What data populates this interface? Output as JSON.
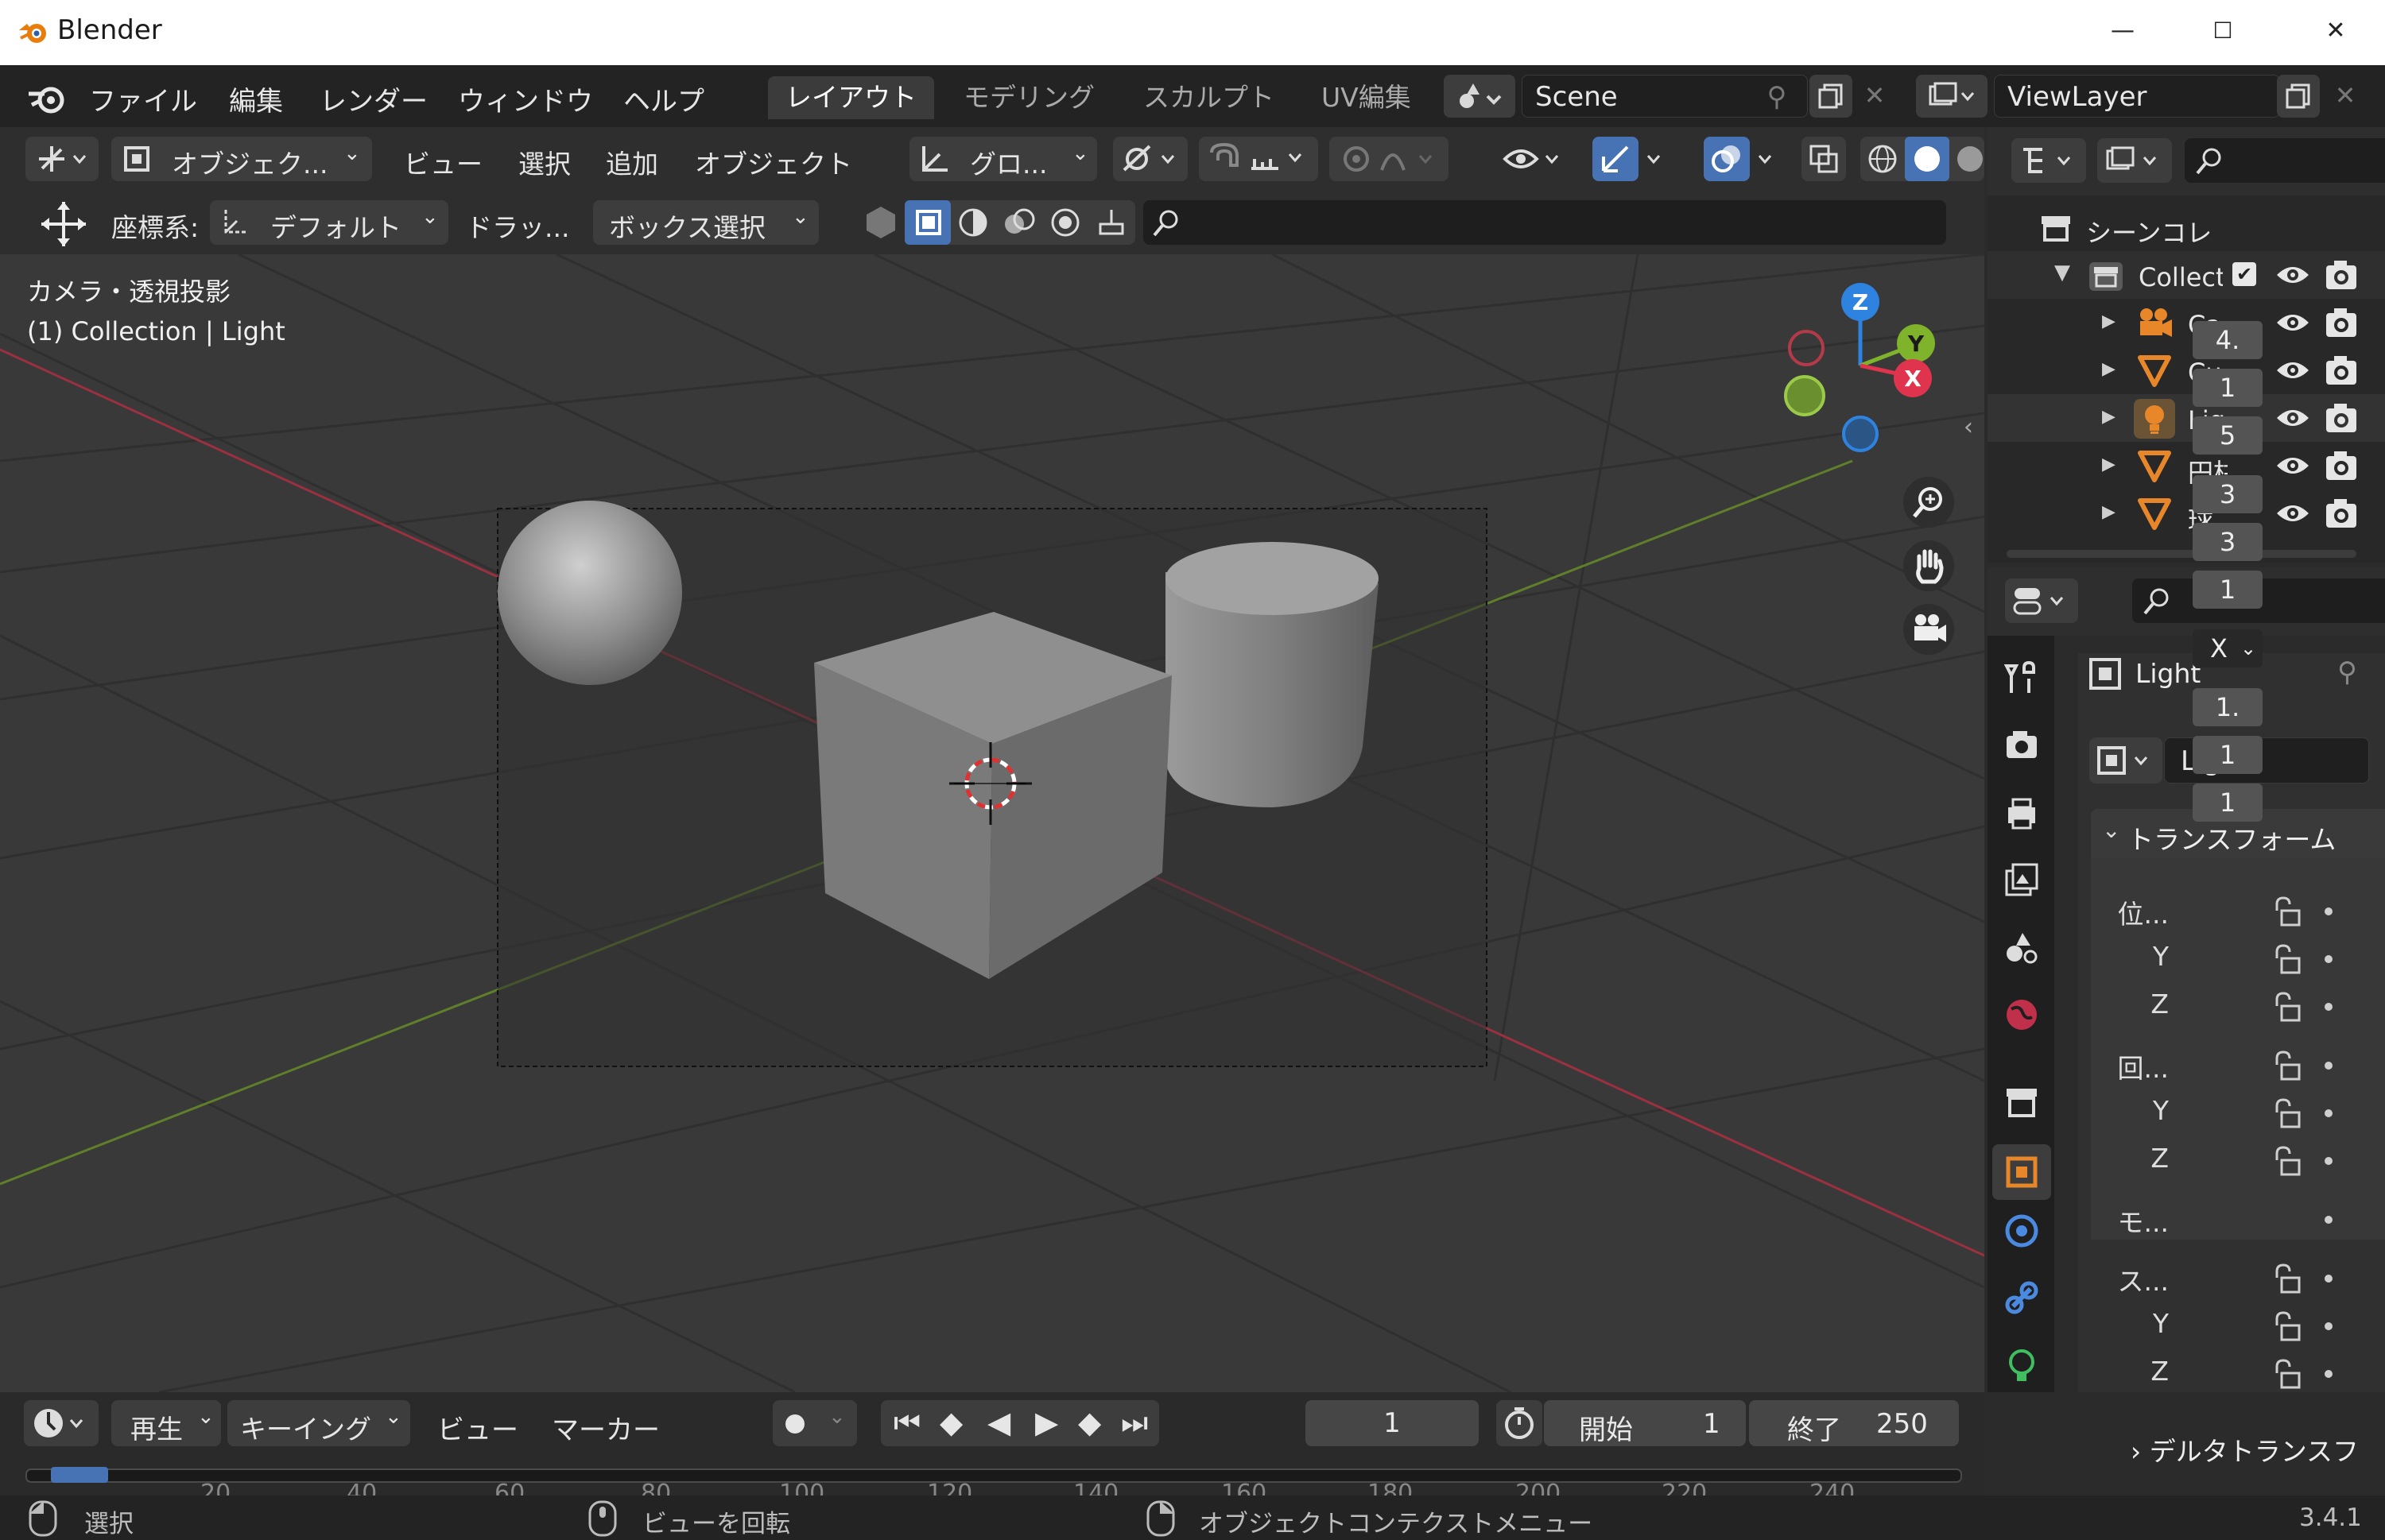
{
  "window": {
    "title": "Blender",
    "minimize": "—",
    "maximize": "☐",
    "close": "✕"
  },
  "menu": [
    "ファイル",
    "編集",
    "レンダー",
    "ウィンドウ",
    "ヘルプ"
  ],
  "workspaces": [
    {
      "label": "レイアウト",
      "active": true
    },
    {
      "label": "モデリング"
    },
    {
      "label": "スカルプト"
    },
    {
      "label": "UV編集"
    }
  ],
  "scene": {
    "name": "Scene"
  },
  "viewlayer": {
    "name": "ViewLayer"
  },
  "viewport_header": {
    "mode": "オブジェク...",
    "menus": [
      "ビュー",
      "選択",
      "追加",
      "オブジェクト"
    ],
    "transform": "グロ...",
    "coord_label": "座標系:",
    "coord_value": "デフォルト",
    "drag_label": "ドラッ...",
    "select_mode": "ボックス選択"
  },
  "viewport_info": {
    "line1": "カメラ・透視投影",
    "line2": "(1) Collection | Light"
  },
  "gizmo": {
    "z": "Z",
    "y": "Y",
    "x": "X"
  },
  "outliner": {
    "scene_collection": "シーンコレ",
    "collection": "Collecti",
    "items": [
      {
        "label": "Ca",
        "icon": "camera-icon"
      },
      {
        "label": "Cu",
        "icon": "mesh-icon"
      },
      {
        "label": "Lig",
        "icon": "light-icon"
      },
      {
        "label": "円柱",
        "icon": "mesh-icon"
      },
      {
        "label": "球",
        "icon": "mesh-icon"
      }
    ]
  },
  "properties": {
    "object_name": "Light",
    "data_name": "Light",
    "transform_header": "トランスフォーム",
    "location_label": "位...",
    "location": [
      "4.",
      "1",
      "5"
    ],
    "rotation_label": "回...",
    "rotation": [
      "3",
      "3",
      "1"
    ],
    "mode_label": "モ...",
    "mode_value": "X",
    "scale_label": "ス...",
    "scale": [
      "1.",
      "1",
      "1"
    ],
    "axis_y": "Y",
    "axis_z": "Z",
    "delta": "デルタトランスフ"
  },
  "timeline": {
    "play_menu": "再生",
    "keying": "キーイング",
    "view": "ビュー",
    "marker": "マーカー",
    "current_frame": "1",
    "start_label": "開始",
    "start": "1",
    "end_label": "終了",
    "end": "250",
    "ticks": [
      "20",
      "40",
      "60",
      "80",
      "100",
      "120",
      "140",
      "160",
      "180",
      "200",
      "220",
      "240"
    ]
  },
  "status": {
    "select": "選択",
    "rotate": "ビューを回転",
    "context": "オブジェクトコンテクストメニュー",
    "version": "3.4.1"
  },
  "colors": {
    "accent_blue": "#4772b3",
    "axis_x": "#e0344e",
    "axis_y": "#7fb32c",
    "axis_z": "#2f83e0",
    "orange": "#e8862a"
  }
}
